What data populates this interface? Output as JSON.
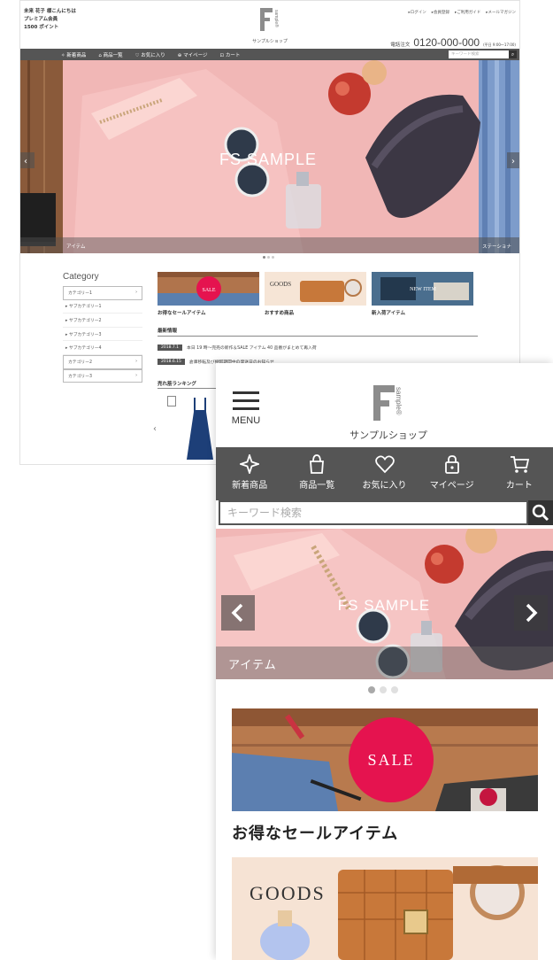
{
  "desktop": {
    "user": {
      "greeting": "未来 花子 様こんにちは",
      "member_rank": "プレミアム会員",
      "points": "1500 ポイント"
    },
    "logo": {
      "letter": "F",
      "side_text": "sample®",
      "shop_name": "サンプルショップ"
    },
    "header_links": [
      "▸ログイン",
      "▸会員登録",
      "▸ご利用ガイド",
      "▸メールマガジン"
    ],
    "tel": {
      "label": "電話注文",
      "number": "0120-000-000",
      "hours": "(平日 9:00〜17:00)"
    },
    "nav": [
      "✧ 新着商品",
      "⌂ 商品一覧",
      "♡ お気に入り",
      "⊕ マイページ",
      "⊡ カート"
    ],
    "search_placeholder": "キーワード検索",
    "hero": {
      "title": "FS SAMPLE",
      "caption_left": "アイテム",
      "caption_right": "ステーショナ"
    },
    "category": {
      "title": "Category",
      "items": [
        {
          "label": "カテゴリー1",
          "type": "boxed"
        },
        {
          "label": "▸ サブカテゴリー1",
          "type": "sub"
        },
        {
          "label": "▸ サブカテゴリー2",
          "type": "sub"
        },
        {
          "label": "▸ サブカテゴリー3",
          "type": "sub"
        },
        {
          "label": "▸ サブカテゴリー4",
          "type": "sub"
        },
        {
          "label": "カテゴリー2",
          "type": "boxed"
        },
        {
          "label": "カテゴリー3",
          "type": "boxed"
        }
      ]
    },
    "tiles": [
      {
        "caption": "お得なセールアイテム",
        "badge": "SALE"
      },
      {
        "caption": "おすすめ商品",
        "badge": "GOODS"
      },
      {
        "caption": "新入荷アイテム",
        "badge": "NEW ITEM"
      }
    ],
    "news": {
      "title": "最新情報",
      "items": [
        {
          "date": "2018.7.1",
          "text": "本日 19 時〜完売の新作＆SALE アイテム 40 品番がまとめて再入荷"
        },
        {
          "date": "2018.6.15",
          "text": "倉庫移転及び棚卸期間中の発送日のお知らせ"
        }
      ]
    },
    "ranking_title": "売れ筋ランキング"
  },
  "mobile": {
    "menu_label": "MENU",
    "logo": {
      "letter": "F",
      "side_text": "sample®",
      "shop_name": "サンプルショップ"
    },
    "nav": [
      {
        "label": "新着商品",
        "icon": "sparkle-icon"
      },
      {
        "label": "商品一覧",
        "icon": "shopping-bag-icon"
      },
      {
        "label": "お気に入り",
        "icon": "heart-icon"
      },
      {
        "label": "マイページ",
        "icon": "lock-icon"
      },
      {
        "label": "カート",
        "icon": "cart-icon"
      }
    ],
    "search_placeholder": "キーワード検索",
    "hero": {
      "title": "FS SAMPLE",
      "caption": "アイテム"
    },
    "tiles": [
      {
        "caption": "お得なセールアイテム",
        "badge": "SALE"
      },
      {
        "caption": "",
        "badge": "GOODS"
      }
    ]
  },
  "colors": {
    "nav_bg": "#555555",
    "sale_red": "#e5134f",
    "hero_pink": "#f4b3b4"
  }
}
